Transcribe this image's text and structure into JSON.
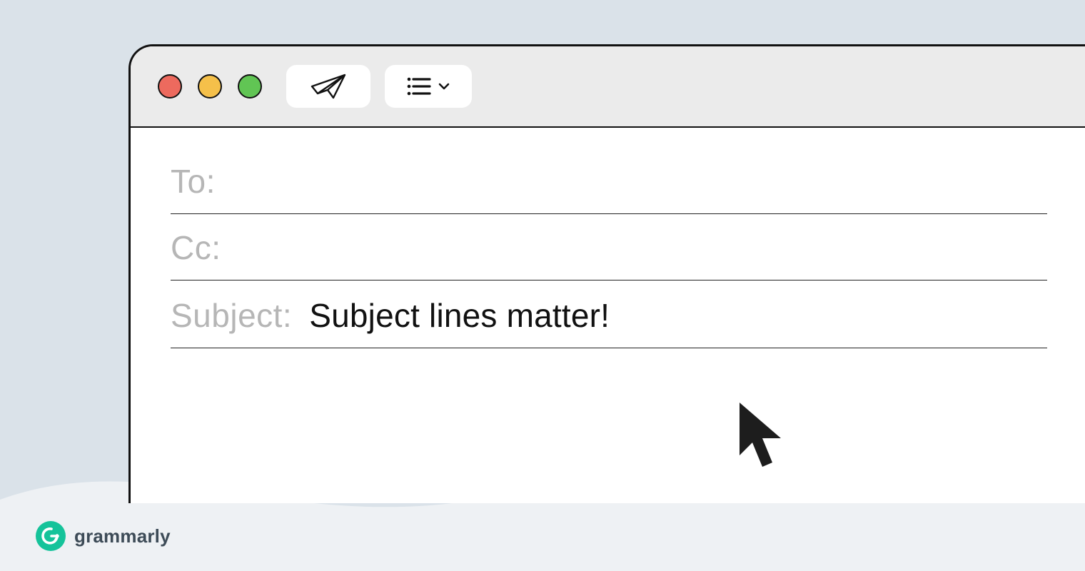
{
  "compose": {
    "to_label": "To:",
    "cc_label": "Cc:",
    "subject_label": "Subject:",
    "to_value": "",
    "cc_value": "",
    "subject_value": "Subject lines matter!"
  },
  "window_controls": {
    "close": "close",
    "minimize": "minimize",
    "maximize": "maximize"
  },
  "toolbar": {
    "send_icon": "paper-plane",
    "format_icon": "list",
    "format_caret": "chevron-down"
  },
  "brand": {
    "name": "grammarly",
    "badge_letter": "G"
  },
  "colors": {
    "page_bg": "#dae2e9",
    "wave_bg": "#eef1f4",
    "titlebar_bg": "#ebebeb",
    "label_gray": "#b6b6b6",
    "text": "#111111",
    "brand_green": "#15c39a",
    "dot_red": "#ed6a5e",
    "dot_yellow": "#f5c04a",
    "dot_green": "#61c554"
  }
}
